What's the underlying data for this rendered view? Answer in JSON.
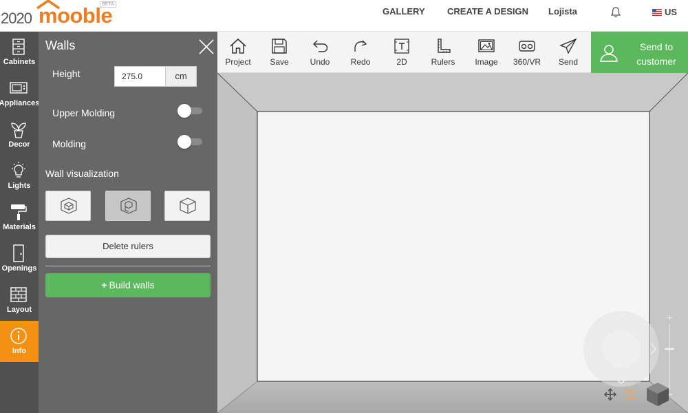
{
  "header": {
    "logo_numbers": "2020",
    "logo_brand": "mooble",
    "logo_badge": "BETA",
    "nav": [
      "GALLERY",
      "CREATE A DESIGN",
      "Lojista"
    ],
    "language": "US"
  },
  "rail": {
    "items": [
      {
        "label": "Cabinets",
        "icon": "cabinet-icon"
      },
      {
        "label": "Appliances",
        "icon": "microwave-icon"
      },
      {
        "label": "Decor",
        "icon": "plant-icon"
      },
      {
        "label": "Lights",
        "icon": "bulb-icon"
      },
      {
        "label": "Materials",
        "icon": "paint-roller-icon"
      },
      {
        "label": "Openings",
        "icon": "door-icon"
      },
      {
        "label": "Layout",
        "icon": "brick-wall-icon"
      },
      {
        "label": "Info",
        "icon": "info-icon"
      }
    ],
    "active": "Info",
    "active_color": "#f49012"
  },
  "panel": {
    "title": "Walls",
    "height_label": "Height",
    "height_value": "275.0",
    "height_unit": "cm",
    "upper_molding_label": "Upper Molding",
    "upper_molding_on": false,
    "molding_label": "Molding",
    "molding_on": false,
    "wall_visualization_label": "Wall visualization",
    "visualization_selected": 2,
    "delete_rulers_label": "Delete rulers",
    "build_walls_label": "Build walls",
    "accent_color": "#5cb85c"
  },
  "toolbar": {
    "tools": [
      {
        "label": "Project",
        "icon": "home-icon"
      },
      {
        "label": "Save",
        "icon": "save-icon"
      },
      {
        "label": "Undo",
        "icon": "undo-icon"
      },
      {
        "label": "Redo",
        "icon": "redo-icon"
      },
      {
        "label": "2D",
        "icon": "2d-icon"
      },
      {
        "label": "Rulers",
        "icon": "ruler-icon"
      },
      {
        "label": "Image",
        "icon": "image-icon"
      },
      {
        "label": "360/VR",
        "icon": "vr-headset-icon"
      },
      {
        "label": "Send",
        "icon": "paper-plane-icon"
      }
    ],
    "send_to_customer_line1": "Send to",
    "send_to_customer_line2": "customer"
  }
}
